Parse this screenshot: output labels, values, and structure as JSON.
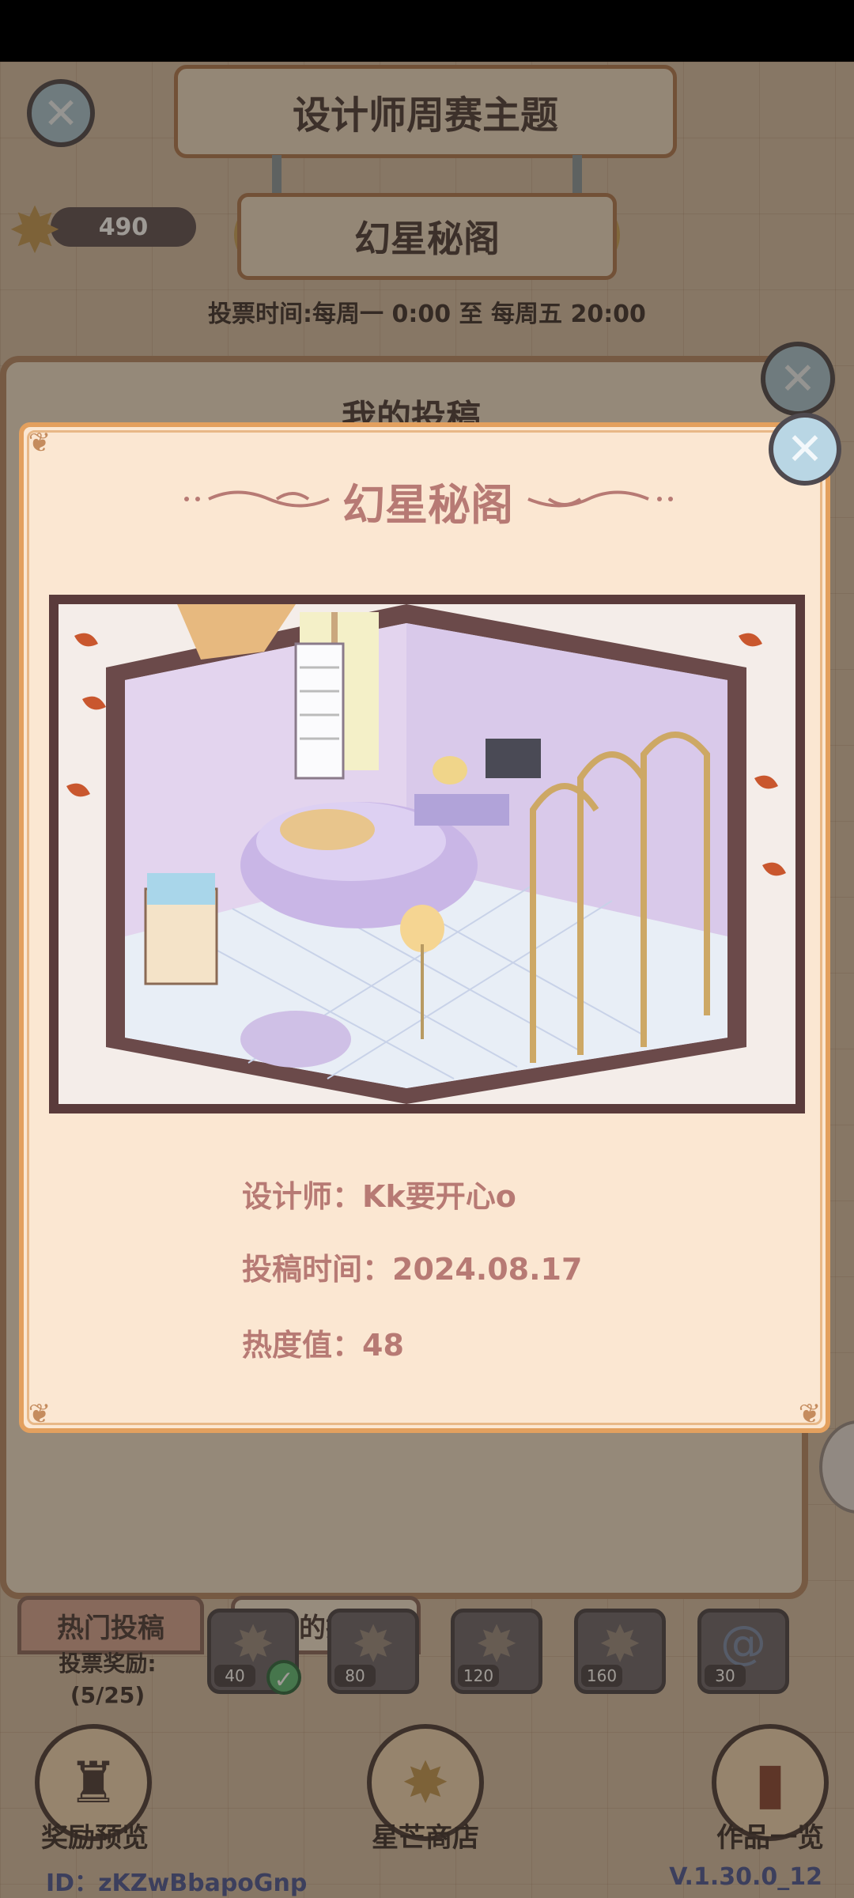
{
  "header": {
    "title": "设计师周赛主题",
    "theme_name": "幻星秘阁",
    "star_count": "490",
    "vote_time": "投票时间:每周一 0:00 至 每周五 20:00"
  },
  "back_panel": {
    "title": "我的投稿",
    "tabs": [
      {
        "label": "热门投稿"
      },
      {
        "label": "我的投稿"
      }
    ],
    "reward_label": "投票奖励:",
    "reward_progress": "(5/25)",
    "reward_tiers": [
      "40",
      "80",
      "120",
      "160",
      "30"
    ]
  },
  "bottom": {
    "reward_preview": "奖励预览",
    "star_shop": "星芒商店",
    "works_list": "作品一览",
    "user_id": "ID：zKZwBbapoGnp",
    "version": "V.1.30.0_12"
  },
  "card": {
    "title": "幻星秘阁",
    "designer": "设计师：Kk要开心o",
    "submit_time": "投稿时间：2024.08.17",
    "heat": "热度值：48"
  },
  "colors": {
    "card_bg": "#fbe7d2",
    "card_border": "#e3a05e",
    "title_pink": "#b77a74",
    "photo_frame": "#5a3b3b"
  }
}
